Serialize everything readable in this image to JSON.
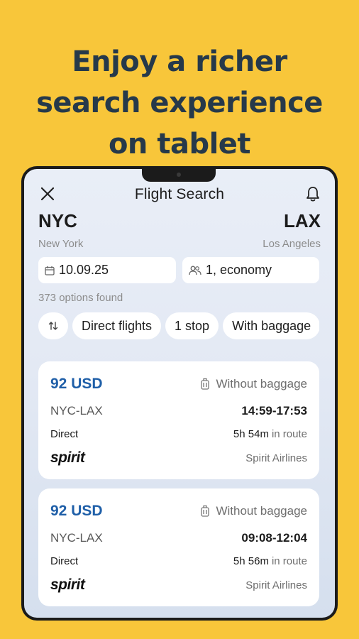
{
  "headline": [
    "Enjoy a richer",
    "search experience",
    "on tablet"
  ],
  "header": {
    "title": "Flight Search",
    "left_icon": "close-icon",
    "right_icon": "bell-icon"
  },
  "route": {
    "origin_code": "NYC",
    "origin_city": "New York",
    "destination_code": "LAX",
    "destination_city": "Los Angeles"
  },
  "search": {
    "date": "10.09.25",
    "passengers": "1, economy"
  },
  "results": {
    "count_text": "373 options found"
  },
  "filters": [
    {
      "label": "Direct flights"
    },
    {
      "label": "1 stop"
    },
    {
      "label": "With baggage"
    }
  ],
  "flights": [
    {
      "price": "92 USD",
      "baggage": "Without baggage",
      "route": "NYC-LAX",
      "times": "14:59-17:53",
      "stops": "Direct",
      "duration": "5h 54m",
      "duration_suffix": "in route",
      "logo": "spirit",
      "airline": "Spirit Airlines"
    },
    {
      "price": "92 USD",
      "baggage": "Without baggage",
      "route": "NYC-LAX",
      "times": "09:08-12:04",
      "stops": "Direct",
      "duration": "5h 56m",
      "duration_suffix": "in route",
      "logo": "spirit",
      "airline": "Spirit Airlines"
    }
  ],
  "colors": {
    "background": "#F8C63A",
    "headline": "#26394A",
    "price": "#1F5FA8"
  }
}
